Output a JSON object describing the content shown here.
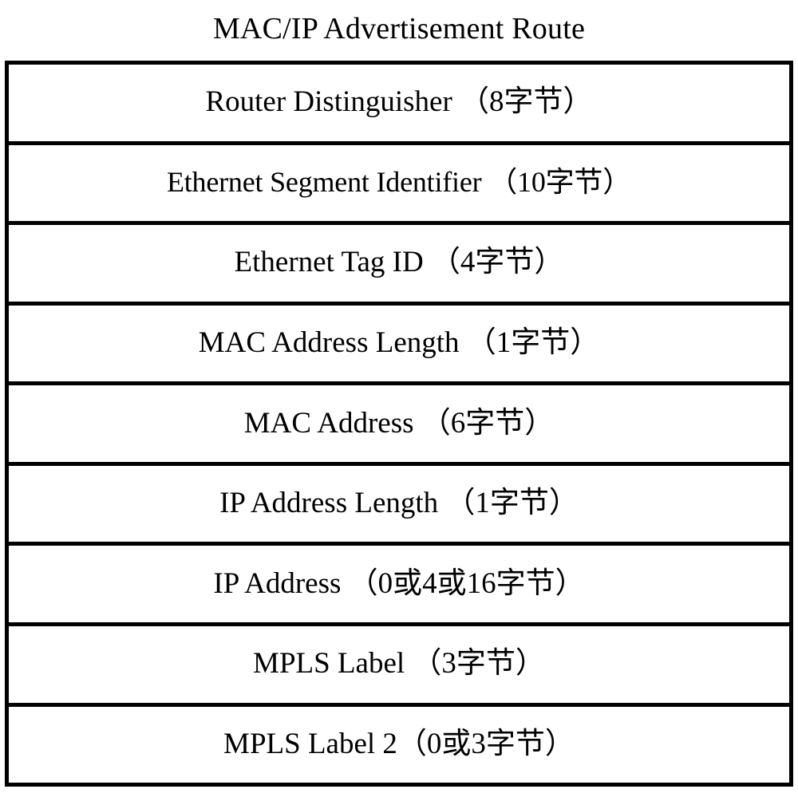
{
  "figure": {
    "title": "MAC/IP Advertisement Route",
    "colors": {
      "border": "#000000",
      "cell_background": "#ffffff",
      "text": "#000000"
    }
  },
  "packet_table": {
    "row_count": 9,
    "rows": [
      {
        "label": "Router Distinguisher （8字节）",
        "field": "Router Distinguisher",
        "size": "8字节"
      },
      {
        "label": "Ethernet Segment Identifier （10字节）",
        "field": "Ethernet Segment Identifier",
        "size": "10字节"
      },
      {
        "label": "Ethernet Tag ID （4字节）",
        "field": "Ethernet Tag ID",
        "size": "4字节"
      },
      {
        "label": "MAC Address Length （1字节）",
        "field": "MAC Address Length",
        "size": "1字节"
      },
      {
        "label": "MAC Address （6字节）",
        "field": "MAC Address",
        "size": "6字节"
      },
      {
        "label": "IP Address Length （1字节）",
        "field": "IP Address Length",
        "size": "1字节"
      },
      {
        "label": "IP Address （0或4或16字节）",
        "field": "IP Address",
        "size": "0或4或16字节"
      },
      {
        "label": "MPLS Label （3字节）",
        "field": "MPLS Label",
        "size": "3字节"
      },
      {
        "label": "MPLS Label 2（0或3字节）",
        "field": "MPLS Label 2",
        "size": "0或3字节"
      }
    ]
  }
}
